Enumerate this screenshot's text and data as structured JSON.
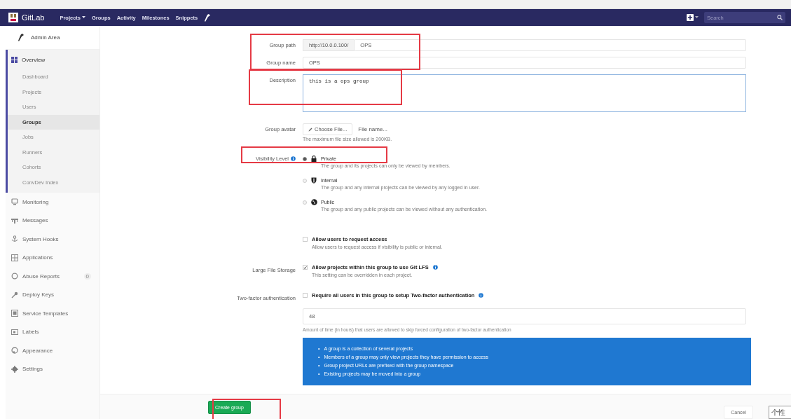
{
  "navbar": {
    "logo": "GitLab",
    "links": [
      {
        "label": "Projects",
        "dropdown": true
      },
      {
        "label": "Groups",
        "dropdown": false
      },
      {
        "label": "Activity",
        "dropdown": false
      },
      {
        "label": "Milestones",
        "dropdown": false
      },
      {
        "label": "Snippets",
        "dropdown": false
      }
    ],
    "search": {
      "placeholder": "Search"
    }
  },
  "sidebar": {
    "title": "Admin Area",
    "items": [
      {
        "label": "Overview",
        "selected": false,
        "expanded": true,
        "children": [
          {
            "label": "Dashboard",
            "selected": false
          },
          {
            "label": "Projects",
            "selected": false
          },
          {
            "label": "Users",
            "selected": false
          },
          {
            "label": "Groups",
            "selected": true
          },
          {
            "label": "Jobs",
            "selected": false
          },
          {
            "label": "Runners",
            "selected": false
          },
          {
            "label": "Cohorts",
            "selected": false
          },
          {
            "label": "ConvDev Index",
            "selected": false
          }
        ]
      },
      {
        "label": "Monitoring",
        "selected": false
      },
      {
        "label": "Messages",
        "selected": false
      },
      {
        "label": "System Hooks",
        "selected": false
      },
      {
        "label": "Applications",
        "selected": false
      },
      {
        "label": "Abuse Reports",
        "selected": false,
        "badge": "0"
      },
      {
        "label": "Deploy Keys",
        "selected": false
      },
      {
        "label": "Service Templates",
        "selected": false
      },
      {
        "label": "Labels",
        "selected": false
      },
      {
        "label": "Appearance",
        "selected": false
      },
      {
        "label": "Settings",
        "selected": false
      }
    ]
  },
  "form": {
    "sections": [
      {
        "highlighted": true,
        "rows": [
          {
            "kind": "path",
            "label": "Group path",
            "prefix": "http://10.0.0.100/",
            "value": "OPS"
          },
          {
            "kind": "text",
            "label": "Group name",
            "value": "OPS"
          }
        ]
      },
      {
        "highlighted": true,
        "rows": [
          {
            "kind": "textarea",
            "label": "Description",
            "value": "this is a ops group"
          }
        ]
      },
      {
        "highlighted": false,
        "rows": [
          {
            "kind": "file",
            "label": "Group avatar",
            "button": "Choose File...",
            "filename": "File name...",
            "help": "The maximum file size allowed is 200KB."
          }
        ]
      },
      {
        "highlighted": true,
        "rows": [
          {
            "kind": "radios",
            "label": "Visibility Level",
            "info": true,
            "options": [
              {
                "label": "Private",
                "help": "The group and its projects can only be viewed by members.",
                "selected": true
              },
              {
                "label": "Internal",
                "help": "The group and any internal projects can be viewed by any logged in user.",
                "selected": false
              },
              {
                "label": "Public",
                "help": "The group and any public projects can be viewed without any authentication.",
                "selected": false
              }
            ]
          }
        ]
      },
      {
        "highlighted": false,
        "rows": [
          {
            "kind": "checkbox",
            "label": "",
            "title": "Allow users to request access",
            "info": false,
            "help": "Allow users to request access if visibility is public or internal.",
            "checked": false
          },
          {
            "kind": "checkbox",
            "label": "Large File Storage",
            "title": "Allow projects within this group to use Git LFS",
            "info": true,
            "help": "This setting can be overridden in each project.",
            "checked": true
          },
          {
            "kind": "checkbox",
            "label": "Two-factor authentication",
            "title": "Require all users in this group to setup Two-factor authentication",
            "info": true,
            "checked": false
          },
          {
            "kind": "number",
            "label": "",
            "value": "48",
            "help": "Amount of time (in hours) that users are allowed to skip forced configuration of two-factor authentication"
          }
        ]
      }
    ],
    "notice": [
      {
        "bullet": "•",
        "text": "A group is a collection of several projects"
      },
      {
        "bullet": "•",
        "text": "Members of a group may only view projects they have permission to access"
      },
      {
        "bullet": "•",
        "text": "Group project URLs are prefixed with the group namespace"
      },
      {
        "bullet": "•",
        "text": "Existing projects may be moved into a group"
      }
    ],
    "actions": {
      "submit": "Create group",
      "submit_highlighted": true,
      "cancel": "Cancel"
    }
  },
  "side_widget": "个性"
}
